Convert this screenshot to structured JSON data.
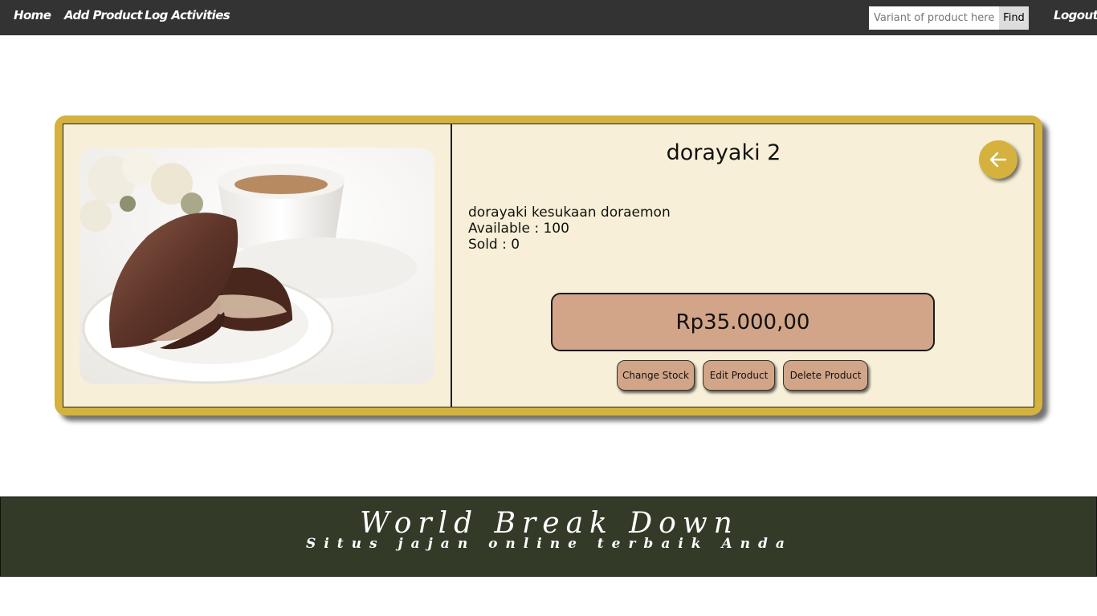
{
  "nav": {
    "home": "Home",
    "add_product": "Add Product",
    "log_activities": "Log Activities",
    "logout": "Logout",
    "search_placeholder": "Variant of product here ...",
    "find": "Find"
  },
  "product": {
    "name": "dorayaki 2",
    "description": "dorayaki kesukaan doraemon",
    "available": "Available : 100",
    "sold": "Sold : 0",
    "price": "Rp35.000,00",
    "image_icon": "dorayaki-photo"
  },
  "actions": {
    "change_stock": "Change Stock",
    "edit_product": "Edit Product",
    "delete_product": "Delete Product",
    "back_icon": "arrow-left-icon"
  },
  "footer": {
    "title": "World Break Down",
    "subtitle": "Situs jajan online terbaik Anda"
  },
  "colors": {
    "navbar": "#333333",
    "card_frame": "#d4b23d",
    "panel": "#f7efd7",
    "button": "#d2a588",
    "footer": "#343a28"
  }
}
